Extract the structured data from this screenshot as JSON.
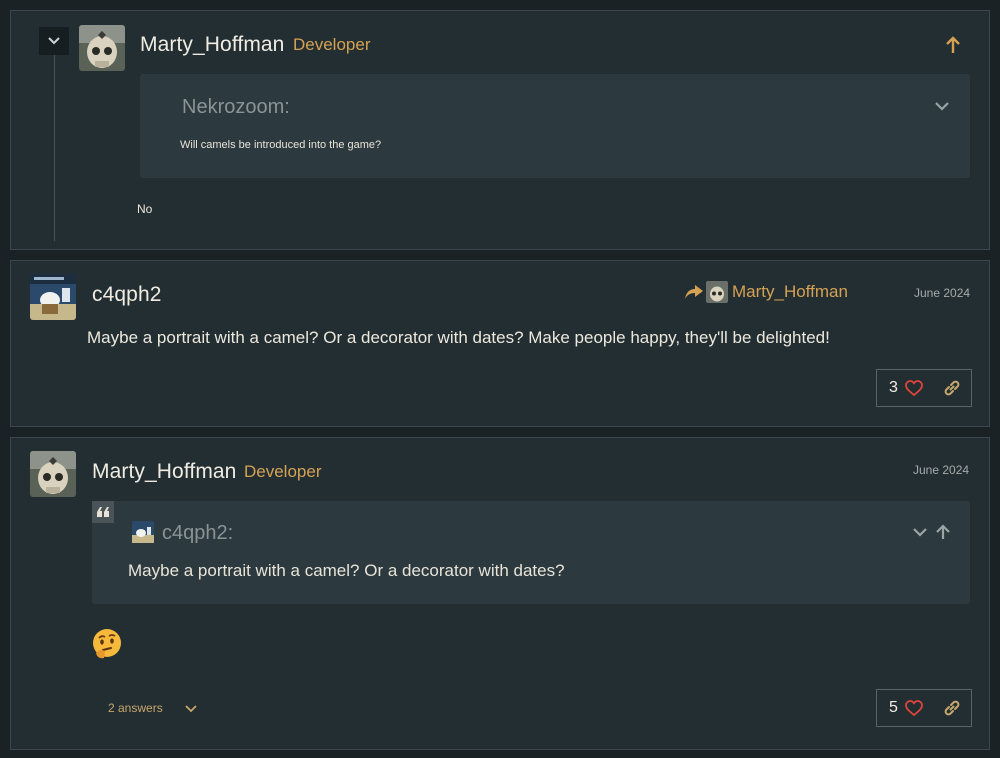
{
  "posts": [
    {
      "author": "Marty_Hoffman",
      "role": "Developer",
      "quote": {
        "author": "Nekrozoom:",
        "text": "Will camels be introduced into the game?"
      },
      "body": "No"
    },
    {
      "author": "c4qph2",
      "reply_to": "Marty_Hoffman",
      "date": "June 2024",
      "body": "Maybe a portrait with a camel? Or a decorator with dates? Make people happy, they'll be delighted!",
      "likes": "3"
    },
    {
      "author": "Marty_Hoffman",
      "role": "Developer",
      "date": "June 2024",
      "quote": {
        "author": "c4qph2:",
        "text": "Maybe a portrait with a camel? Or a decorator with dates?"
      },
      "body_emoji": "thinking-face",
      "answers": "2 answers",
      "likes": "5"
    }
  ],
  "colors": {
    "accent": "#d5a253",
    "background": "#232e33",
    "heart": "#e0453a"
  }
}
